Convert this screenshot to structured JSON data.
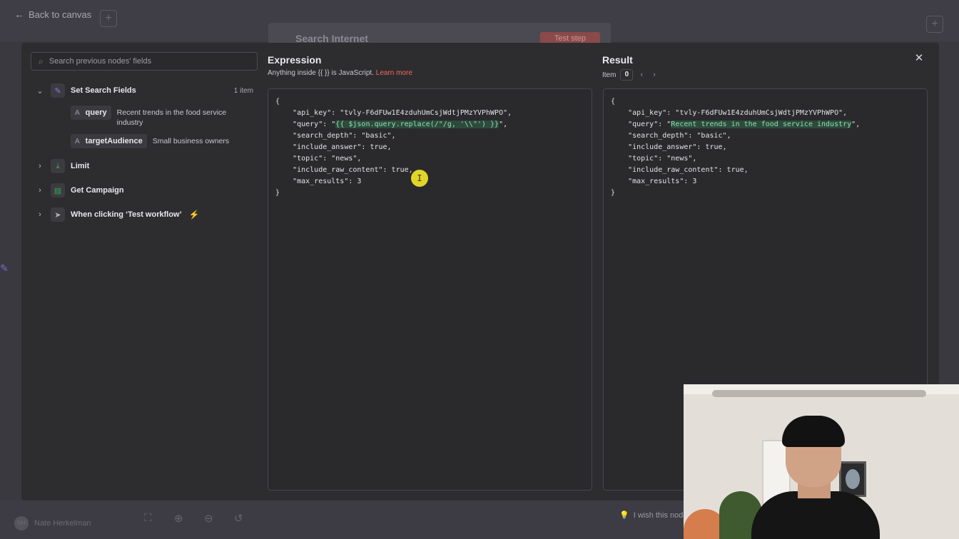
{
  "background": {
    "back_label": "Back to canvas",
    "node_title": "Search Internet",
    "test_step_label": "Test step",
    "user_name": "Nate Herkelman",
    "user_initials": "NH",
    "wish_text": "I wish this node"
  },
  "search": {
    "placeholder": "Search previous nodes' fields"
  },
  "tree": {
    "nodes": [
      {
        "label": "Set Search Fields",
        "count": "1 item",
        "expanded": true,
        "icon": "pencil-icon"
      },
      {
        "label": "Limit",
        "expanded": false,
        "icon": "limit-icon"
      },
      {
        "label": "Get Campaign",
        "expanded": false,
        "icon": "sheets-icon"
      },
      {
        "label": "When clicking ‘Test workflow’",
        "expanded": false,
        "icon": "pointer-icon"
      }
    ],
    "fields": [
      {
        "type": "A",
        "name": "query",
        "value": "Recent trends in the food service industry"
      },
      {
        "type": "A",
        "name": "targetAudience",
        "value": "Small business owners"
      }
    ]
  },
  "expression": {
    "title": "Expression",
    "hint_prefix": "Anything inside {{ }} is JavaScript.",
    "hint_link": "Learn more",
    "lines": [
      {
        "pre": "{",
        "hl": "",
        "post": ""
      },
      {
        "pre": "    \"api_key\": \"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\",",
        "hl": "",
        "post": ""
      },
      {
        "pre": "    \"query\": \"",
        "hl": "{{ $json.query.replace(/\"/g, '\\\\\"') }}",
        "post": "\","
      },
      {
        "pre": "    \"search_depth\": \"basic\",",
        "hl": "",
        "post": ""
      },
      {
        "pre": "    \"include_answer\": true,",
        "hl": "",
        "post": ""
      },
      {
        "pre": "    \"topic\": \"news\",",
        "hl": "",
        "post": ""
      },
      {
        "pre": "    \"include_raw_content\": true,",
        "hl": "",
        "post": ""
      },
      {
        "pre": "    \"max_results\": 3",
        "hl": "",
        "post": ""
      },
      {
        "pre": "}",
        "hl": "",
        "post": ""
      }
    ]
  },
  "result": {
    "title": "Result",
    "item_label": "Item",
    "item_index": "0",
    "lines": [
      {
        "pre": "{",
        "hl": "",
        "post": ""
      },
      {
        "pre": "    \"api_key\": \"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\",",
        "hl": "",
        "post": ""
      },
      {
        "pre": "    \"query\": \"",
        "hl": "Recent trends in the food service industry",
        "post": "\","
      },
      {
        "pre": "    \"search_depth\": \"basic\",",
        "hl": "",
        "post": ""
      },
      {
        "pre": "    \"include_answer\": true,",
        "hl": "",
        "post": ""
      },
      {
        "pre": "    \"topic\": \"news\",",
        "hl": "",
        "post": ""
      },
      {
        "pre": "    \"include_raw_content\": true,",
        "hl": "",
        "post": ""
      },
      {
        "pre": "    \"max_results\": 3",
        "hl": "",
        "post": ""
      },
      {
        "pre": "}",
        "hl": "",
        "post": ""
      }
    ]
  },
  "colors": {
    "accent_link": "#f26b5b",
    "highlight_bg": "#2e4a3c",
    "highlight_text": "#8be0b0",
    "trigger_bolt": "#e5504a"
  }
}
